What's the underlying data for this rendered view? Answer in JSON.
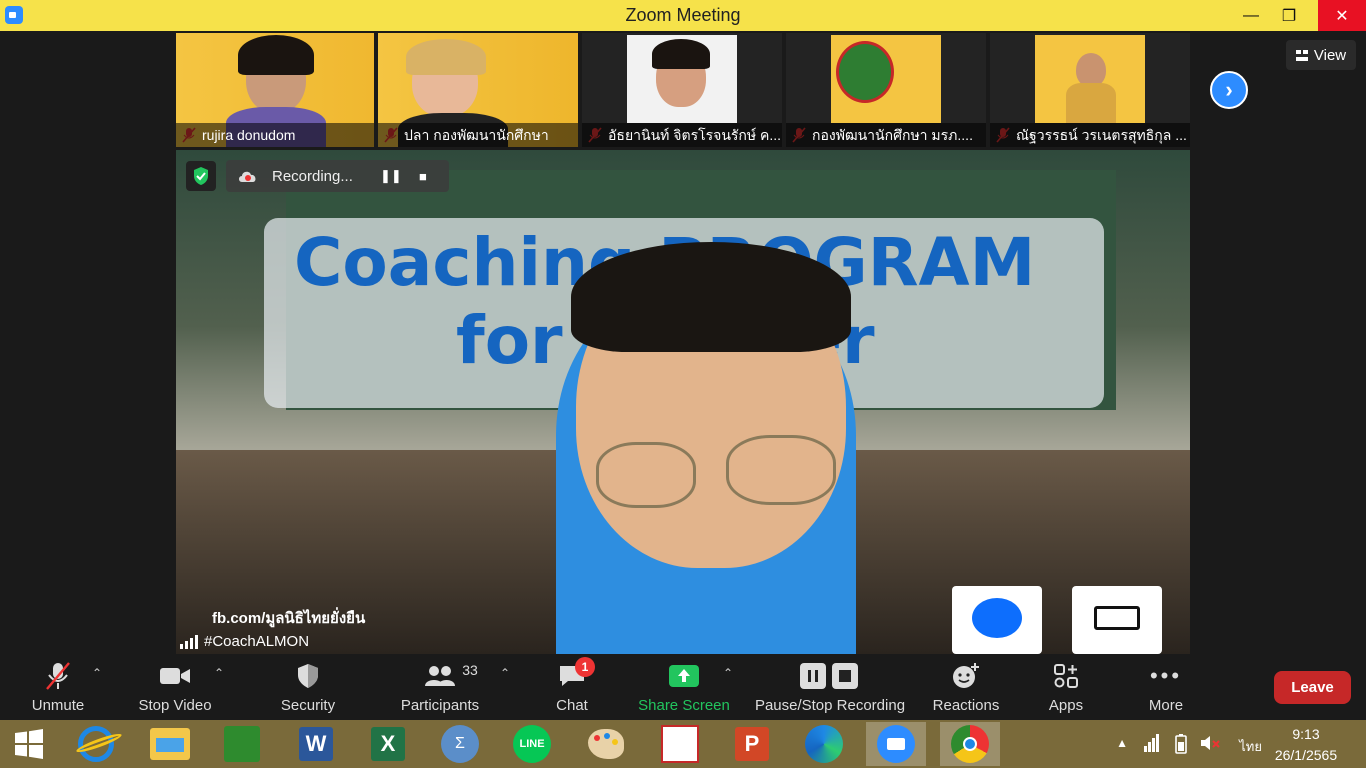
{
  "window": {
    "title": "Zoom Meeting"
  },
  "participants_strip": [
    {
      "name": "rujira donudom",
      "bg": "#f2c240"
    },
    {
      "name": "ปลา กองพัฒนานักศึกษา",
      "bg": "#f2c240"
    },
    {
      "name": "อัธยานินท์ จิตรโรจนรักษ์ ค...",
      "bg": "#2b2b2b"
    },
    {
      "name": "กองพัฒนานักศึกษา มรภ....",
      "bg": "#2b2b2b"
    },
    {
      "name": "ณัฐวรรธน์ วรเนตรสุทธิกุล ...",
      "bg": "#2b2b2b"
    }
  ],
  "view_button": {
    "label": "View"
  },
  "recording": {
    "label": "Recording..."
  },
  "main_video": {
    "speaker_name": "#CoachALMON",
    "overlay_line1": "Coaching PROGRAM",
    "overlay_line2": "for Teacher",
    "fb_text": "fb.com/มูลนิธิไทยยั่งยืน"
  },
  "toolbar": {
    "unmute": "Unmute",
    "stop_video": "Stop Video",
    "security": "Security",
    "participants": "Participants",
    "participants_count": "33",
    "chat": "Chat",
    "chat_badge": "1",
    "share_screen": "Share Screen",
    "pause_stop_recording": "Pause/Stop Recording",
    "reactions": "Reactions",
    "apps": "Apps",
    "more": "More",
    "leave": "Leave"
  },
  "taskbar": {
    "time": "9:13",
    "date": "26/1/2565",
    "language": "ไทย"
  },
  "colors": {
    "accent": "#2d8cff",
    "share": "#22c55e",
    "leave": "#c62828",
    "titlebar": "#f6e24a"
  }
}
